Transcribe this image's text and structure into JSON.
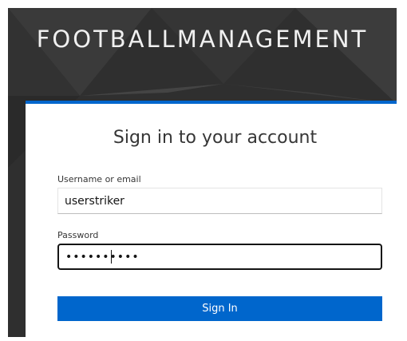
{
  "brand": {
    "title": "FOOTBALLMANAGEMENT"
  },
  "login": {
    "heading": "Sign in to your account",
    "username": {
      "label": "Username or email",
      "value": "userstriker"
    },
    "password": {
      "label": "Password",
      "masked_value": "••••••••••"
    },
    "submit_label": "Sign In"
  },
  "colors": {
    "accent": "#0066cc",
    "backdrop": "#2f2f2f",
    "text": "#363636"
  }
}
